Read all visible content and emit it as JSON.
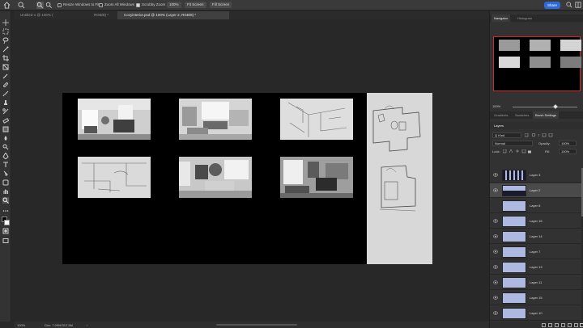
{
  "options_bar": {
    "resize_windows_label": "Resize Windows to Fit",
    "zoom_all_windows_label": "Zoom All Windows",
    "scrubby_zoom_label": "Scrubby Zoom",
    "zoom_value": "100%",
    "fit_screen_label": "Fit Screen",
    "fill_screen_label": "Fill Screen",
    "share_label": "Share"
  },
  "tabs": [
    {
      "label": "Untitled-1 @ 100% (",
      "mode": "RGB/8) *"
    },
    {
      "label": "Cozyinterior.psd @ 100% (Layer 2, RGB/8) *"
    }
  ],
  "status_bar": {
    "zoom": "100%",
    "doc_info": "Doc: 7.09M/312.5M"
  },
  "navigator": {
    "tabs": [
      "Navigator",
      "Histogram"
    ],
    "zoom": "100%"
  },
  "panel_tabs": [
    "Gradients",
    "Swatches",
    "Brush Settings"
  ],
  "layers_panel": {
    "title": "Layers",
    "kind_label": "Q Kind",
    "blend_mode": "Normal",
    "opacity_label": "Opacity:",
    "opacity_value": "100%",
    "lock_label": "Lock:",
    "fill_label": "Fill:",
    "fill_value": "100%",
    "layers": [
      {
        "name": "Layer 3",
        "visible": true,
        "selected": false
      },
      {
        "name": "Layer 2",
        "visible": true,
        "selected": true
      },
      {
        "name": "Layer 8",
        "visible": false,
        "selected": false
      },
      {
        "name": "Layer 16",
        "visible": true,
        "selected": false
      },
      {
        "name": "Layer 14",
        "visible": true,
        "selected": false
      },
      {
        "name": "Layer 7",
        "visible": true,
        "selected": false
      },
      {
        "name": "Layer 13",
        "visible": true,
        "selected": false
      },
      {
        "name": "Layer 11",
        "visible": true,
        "selected": false
      },
      {
        "name": "Layer 15",
        "visible": true,
        "selected": false
      },
      {
        "name": "Layer 10",
        "visible": true,
        "selected": false
      },
      {
        "name": "Layer 12",
        "visible": true,
        "selected": false
      }
    ]
  },
  "colors": {
    "accent": "#2f6bd8",
    "selection": "#cc2b2b",
    "layer_thumb": "#aeb9e2"
  }
}
